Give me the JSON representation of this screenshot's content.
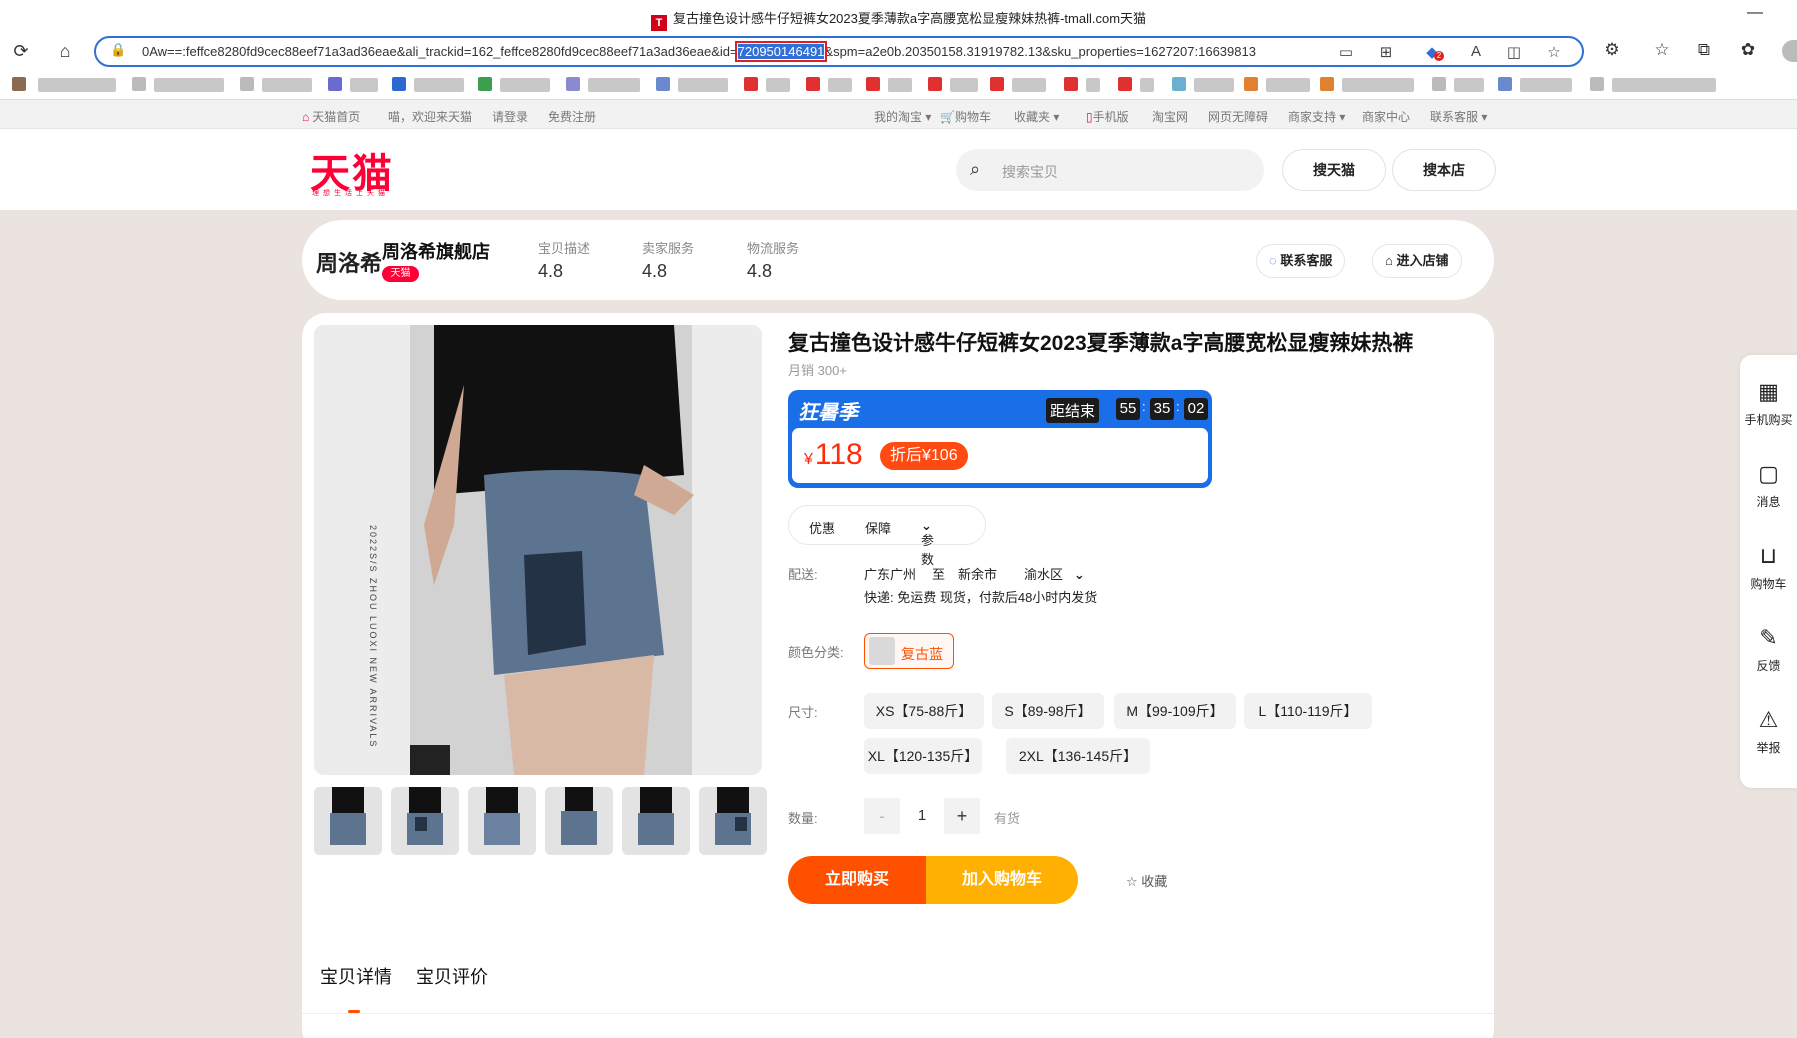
{
  "browser": {
    "window_title": "复古撞色设计感牛仔短裤女2023夏季薄款a字高腰宽松显瘦辣妹热裤-tmall.com天猫",
    "url_prefix": "0Aw==:feffce8280fd9cec88eef71a3ad36eae&ali_trackid=162_feffce8280fd9cec88eef71a3ad36eae&id=",
    "url_highlight": "720950146491",
    "url_suffix": "&spm=a2e0b.20350158.31919782.13&sku_properties=1627207:16639813",
    "notification_badge": "2"
  },
  "site_nav": {
    "home": "天猫首页",
    "welcome": "喵，欢迎来天猫",
    "login": "请登录",
    "register": "免费注册",
    "my_taobao": "我的淘宝",
    "cart": "购物车",
    "favorites": "收藏夹",
    "mobile": "手机版",
    "taobao": "淘宝网",
    "accessibility": "网页无障碍",
    "merchant_support": "商家支持",
    "merchant_center": "商家中心",
    "contact": "联系客服"
  },
  "header": {
    "logo": "天猫",
    "logo_tagline": "理想生活上天猫",
    "search_placeholder": "搜索宝贝",
    "search_tmall": "搜天猫",
    "search_shop": "搜本店"
  },
  "shop": {
    "logo_text": "周洛希",
    "name": "周洛希旗舰店",
    "tag": "天猫",
    "ratings": [
      {
        "label": "宝贝描述",
        "value": "4.8"
      },
      {
        "label": "卖家服务",
        "value": "4.8"
      },
      {
        "label": "物流服务",
        "value": "4.8"
      }
    ],
    "contact_btn": "联系客服",
    "enter_btn": "进入店铺"
  },
  "product": {
    "title": "复古撞色设计感牛仔短裤女2023夏季薄款a字高腰宽松显瘦辣妹热裤",
    "monthly_sales": "月销 300+",
    "image_caption": "2022S/S ZHOU LUOXI NEW ARRIVALS",
    "promo": {
      "name": "狂暑季",
      "ends_label": "距结束",
      "countdown": [
        "55",
        "35",
        "02"
      ],
      "currency": "¥",
      "price": "118",
      "discount": "折后¥106"
    },
    "tabs": [
      "优惠",
      "保障",
      "参数"
    ],
    "delivery_label": "配送:",
    "delivery_from": "广东广州",
    "delivery_to_word": "至",
    "delivery_city": "新余市",
    "delivery_district": "渝水区",
    "delivery_info": "快递: 免运费   现货，付款后48小时内发货",
    "color_label": "颜色分类:",
    "color_option": "复古蓝",
    "size_label": "尺寸:",
    "sizes": [
      "XS【75-88斤】",
      "S【89-98斤】",
      "M【99-109斤】",
      "L【110-119斤】",
      "XL【120-135斤】",
      "2XL【136-145斤】"
    ],
    "qty_label": "数量:",
    "qty_minus": "-",
    "qty_value": "1",
    "qty_plus": "+",
    "stock": "有货",
    "buy_now": "立即购买",
    "add_cart": "加入购物车",
    "favorite": "收藏"
  },
  "detail_tabs": [
    "宝贝详情",
    "宝贝评价"
  ],
  "side_tools": [
    "手机购买",
    "消息",
    "购物车",
    "反馈",
    "举报"
  ],
  "colors": {
    "accent": "#ff5000",
    "tmall_red": "#ff0036",
    "promo_blue": "#1a6fe8",
    "cart_yellow": "#ffb000"
  }
}
